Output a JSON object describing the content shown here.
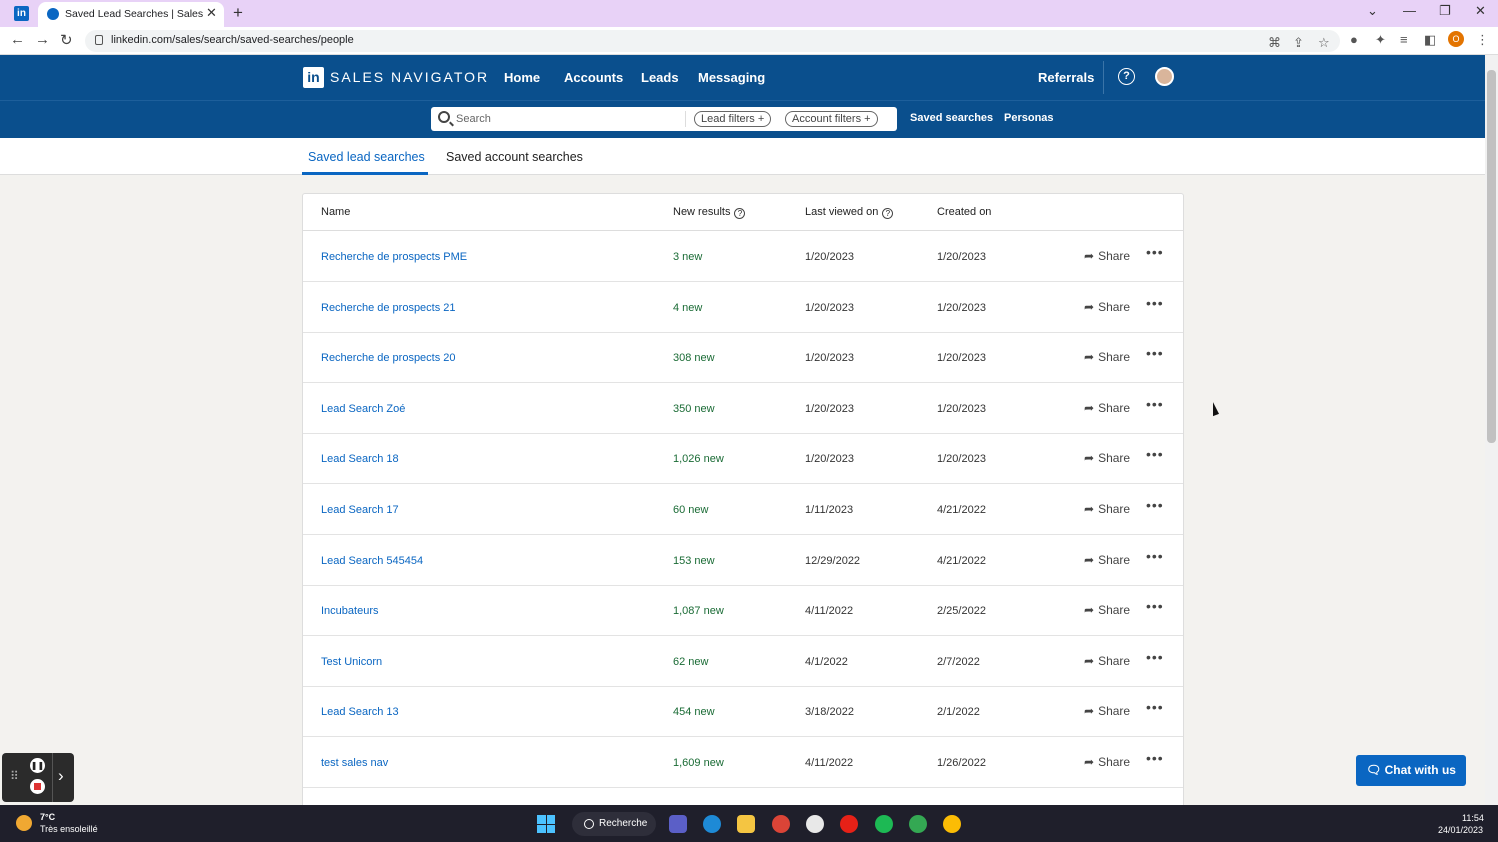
{
  "browser": {
    "tab_title": "Saved Lead Searches | Sales Navi",
    "url": "linkedin.com/sales/search/saved-searches/people",
    "profile_initial": "O"
  },
  "header": {
    "brand": "SALES NAVIGATOR",
    "logo": "in",
    "nav": [
      "Home",
      "Accounts",
      "Leads",
      "Messaging"
    ],
    "referrals": "Referrals",
    "help": "?"
  },
  "subheader": {
    "search_placeholder": "Search",
    "lead_filters": "Lead filters",
    "account_filters": "Account filters",
    "saved_searches": "Saved searches",
    "personas": "Personas"
  },
  "tabs": {
    "leads": "Saved lead searches",
    "accounts": "Saved account searches"
  },
  "table": {
    "headers": {
      "name": "Name",
      "new_results": "New results",
      "last_viewed": "Last viewed on",
      "created": "Created on"
    },
    "share_label": "Share",
    "more_label": "•••",
    "rows": [
      {
        "name": "Recherche de prospects PME",
        "new": "3 new",
        "last": "1/20/2023",
        "created": "1/20/2023"
      },
      {
        "name": "Recherche de prospects 21",
        "new": "4 new",
        "last": "1/20/2023",
        "created": "1/20/2023"
      },
      {
        "name": "Recherche de prospects 20",
        "new": "308 new",
        "last": "1/20/2023",
        "created": "1/20/2023"
      },
      {
        "name": "Lead Search Zoé",
        "new": "350 new",
        "last": "1/20/2023",
        "created": "1/20/2023"
      },
      {
        "name": "Lead Search 18",
        "new": "1,026 new",
        "last": "1/20/2023",
        "created": "1/20/2023"
      },
      {
        "name": "Lead Search 17",
        "new": "60 new",
        "last": "1/11/2023",
        "created": "4/21/2022"
      },
      {
        "name": "Lead Search 545454",
        "new": "153 new",
        "last": "12/29/2022",
        "created": "4/21/2022"
      },
      {
        "name": "Incubateurs",
        "new": "1,087 new",
        "last": "4/11/2022",
        "created": "2/25/2022"
      },
      {
        "name": "Test Unicorn",
        "new": "62 new",
        "last": "4/1/2022",
        "created": "2/7/2022"
      },
      {
        "name": "Lead Search 13",
        "new": "454 new",
        "last": "3/18/2022",
        "created": "2/1/2022"
      },
      {
        "name": "test sales nav",
        "new": "1,609 new",
        "last": "4/11/2022",
        "created": "1/26/2022"
      }
    ]
  },
  "chat": {
    "label": "Chat with us"
  },
  "taskbar": {
    "weather_temp": "7°C",
    "weather_desc": "Très ensoleillé",
    "search_label": "Recherche",
    "time": "11:54",
    "date": "24/01/2023"
  },
  "colors": {
    "brand_blue": "#0a4f8d",
    "link_blue": "#0a66c2",
    "new_green": "#1a6b35",
    "tab_strip": "#e8d2f7"
  }
}
